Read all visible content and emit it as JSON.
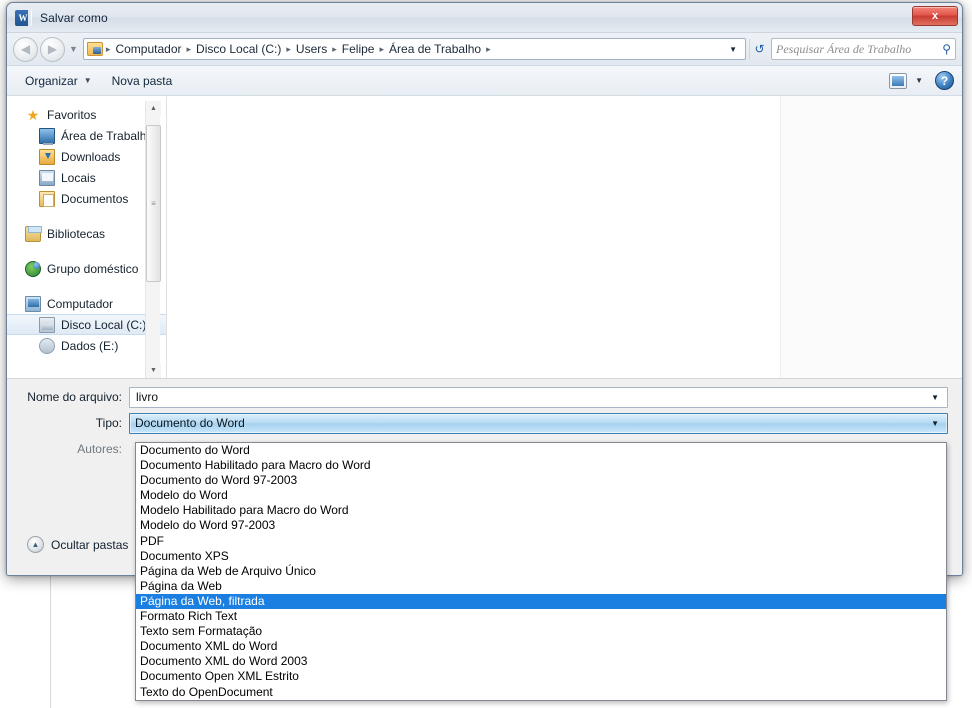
{
  "window": {
    "title": "Salvar como",
    "icon": "word-icon",
    "close_label": "x"
  },
  "nav": {
    "back_icon": "back-arrow-icon",
    "forward_icon": "forward-arrow-icon",
    "recent_icon": "chevron-down-icon",
    "refresh_icon": "refresh-icon",
    "dropdown_icon": "chevron-down-icon",
    "breadcrumbs": [
      "Computador",
      "Disco Local (C:)",
      "Users",
      "Felipe",
      "Área de Trabalho"
    ],
    "separator": "▸"
  },
  "search": {
    "placeholder": "Pesquisar Área de Trabalho",
    "icon": "search-icon"
  },
  "toolbar": {
    "organize_label": "Organizar",
    "new_folder_label": "Nova pasta",
    "caret": "▼",
    "view_icon": "view-mode-icon",
    "help_label": "?"
  },
  "sidebar": {
    "groups": [
      {
        "header": {
          "label": "Favoritos",
          "icon": "star-icon"
        },
        "items": [
          {
            "label": "Área de Trabalho",
            "icon": "desktop-icon"
          },
          {
            "label": "Downloads",
            "icon": "downloads-icon"
          },
          {
            "label": "Locais",
            "icon": "places-icon"
          },
          {
            "label": "Documentos",
            "icon": "documents-icon"
          }
        ]
      },
      {
        "header": {
          "label": "Bibliotecas",
          "icon": "libraries-icon"
        },
        "items": []
      },
      {
        "header": {
          "label": "Grupo doméstico",
          "icon": "homegroup-icon"
        },
        "items": []
      },
      {
        "header": {
          "label": "Computador",
          "icon": "computer-icon"
        },
        "items": [
          {
            "label": "Disco Local (C:)",
            "icon": "harddisk-icon",
            "selected": true
          },
          {
            "label": "Dados (E:)",
            "icon": "disk-icon"
          }
        ]
      }
    ],
    "scrollbar": {
      "up_arrow": "▲",
      "down_arrow": "▼",
      "grip": "≡"
    }
  },
  "form": {
    "filename_label": "Nome do arquivo:",
    "filename_value": "livro",
    "type_label": "Tipo:",
    "type_value": "Documento do Word",
    "authors_label": "Autores:",
    "authors_value": "",
    "hide_folders_label": "Ocultar pastas",
    "hide_folders_icon": "chevron-up-circle-icon",
    "caret": "▼"
  },
  "type_dropdown": {
    "selected_index": 10,
    "options": [
      "Documento do Word",
      "Documento Habilitado para Macro do Word",
      "Documento do Word 97-2003",
      "Modelo do Word",
      "Modelo Habilitado para Macro do Word",
      "Modelo do Word 97-2003",
      "PDF",
      "Documento XPS",
      "Página da Web de Arquivo Único",
      "Página da Web",
      "Página da Web, filtrada",
      "Formato Rich Text",
      "Texto sem Formatação",
      "Documento XML do Word",
      "Documento XML do Word 2003",
      "Documento Open XML Estrito",
      "Texto do OpenDocument"
    ]
  },
  "colors": {
    "accent": "#1a7fe0",
    "combo_border": "#3c7fb1",
    "close_button": "#c93c31"
  }
}
